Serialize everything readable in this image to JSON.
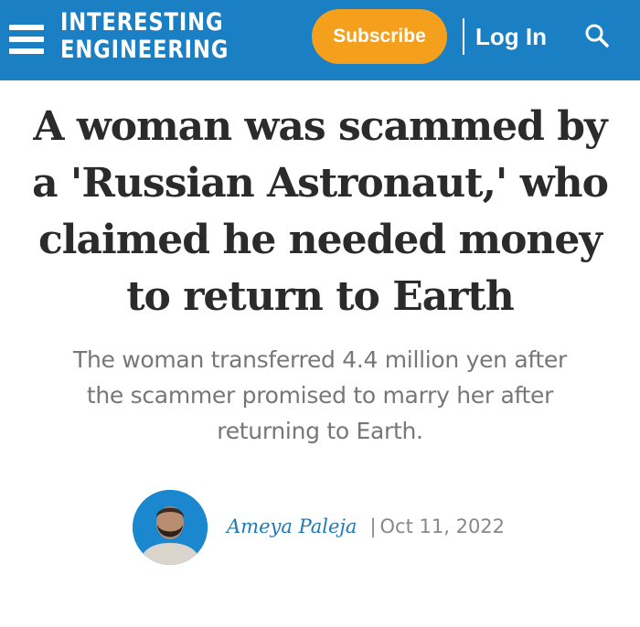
{
  "header": {
    "logo_line1": "INTERESTING",
    "logo_line2": "ENGINEERING",
    "subscribe_label": "Subscribe",
    "login_label": "Log In",
    "menu_icon": "hamburger-menu-icon",
    "search_icon": "search-icon",
    "colors": {
      "header_bg": "#1b7fc4",
      "subscribe_bg": "#f5a01d"
    }
  },
  "article": {
    "headline": "A woman was scammed by a 'Russian Astronaut,' who claimed he needed money to return to Earth",
    "subheadline": "The woman transferred 4.4 million yen after the scammer promised to marry her after returning to Earth.",
    "author": "Ameya Paleja",
    "separator": "|",
    "date": "Oct 11, 2022"
  }
}
